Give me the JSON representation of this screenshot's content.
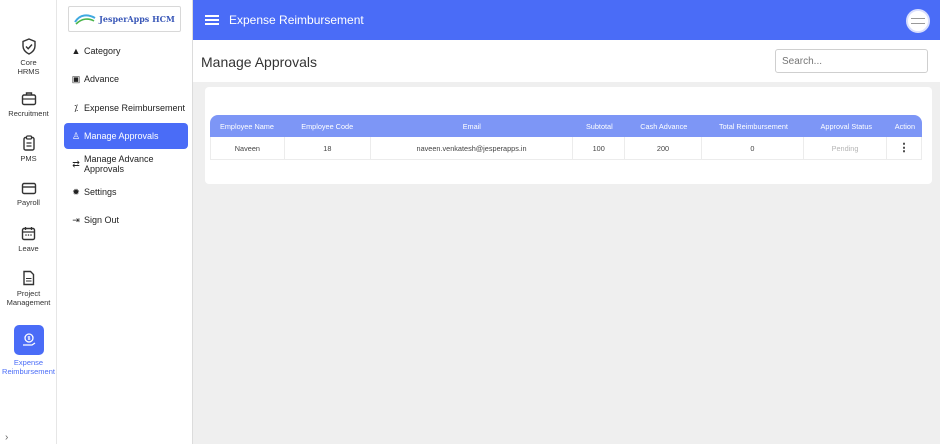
{
  "app": {
    "logo_text": "JesperApps HCM",
    "brand_color": "#4a6cf7"
  },
  "rail": {
    "items": [
      {
        "label": "Core HRMS",
        "icon": "shield-check-icon"
      },
      {
        "label": "Recruitment",
        "icon": "briefcase-icon"
      },
      {
        "label": "PMS",
        "icon": "clipboard-icon"
      },
      {
        "label": "Payroll",
        "icon": "credit-card-icon"
      },
      {
        "label": "Leave",
        "icon": "calendar-icon"
      },
      {
        "label": "Project Management",
        "icon": "document-icon"
      },
      {
        "label": "Expense Reimbursement",
        "icon": "expense-hand-icon",
        "active": true
      }
    ],
    "expand_glyph": "›"
  },
  "menu": {
    "items": [
      {
        "label": "Category",
        "icon": "shapes-icon",
        "glyph": "▲"
      },
      {
        "label": "Advance",
        "icon": "wallet-icon",
        "glyph": "▣"
      },
      {
        "label": "Expense Reimbursement",
        "icon": "percent-icon",
        "glyph": "⁒"
      },
      {
        "label": "Manage Approvals",
        "icon": "user-icon",
        "glyph": "♙",
        "active": true
      },
      {
        "label": "Manage Advance Approvals",
        "icon": "exchange-icon",
        "glyph": "⇄"
      },
      {
        "label": "Settings",
        "icon": "gear-icon",
        "glyph": "✹"
      },
      {
        "label": "Sign Out",
        "icon": "sign-out-icon",
        "glyph": "⇥"
      }
    ]
  },
  "topbar": {
    "title": "Expense Reimbursement"
  },
  "page": {
    "title": "Manage Approvals",
    "search_placeholder": "Search..."
  },
  "table": {
    "columns": [
      "Employee Name",
      "Employee Code",
      "Email",
      "Subtotal",
      "Cash Advance",
      "Total Reimbursement",
      "Approval Status",
      "Action"
    ],
    "rows": [
      {
        "employee_name": "Naveen",
        "employee_code": "18",
        "email": "naveen.venkatesh@jesperapps.in",
        "subtotal": "100",
        "cash_advance": "200",
        "total_reimbursement": "0",
        "approval_status": "Pending",
        "action_glyph": "⋮"
      }
    ]
  }
}
